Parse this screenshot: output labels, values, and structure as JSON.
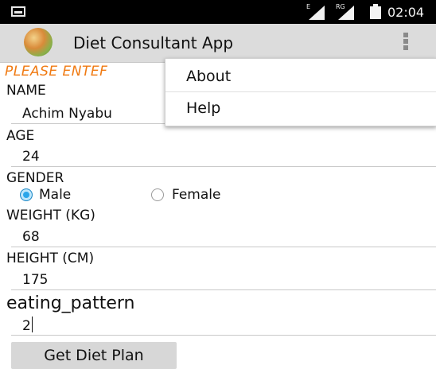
{
  "status_bar": {
    "time": "02:04",
    "network_label": "E",
    "roaming_label": "RG"
  },
  "action_bar": {
    "title": "Diet Consultant App",
    "app_icon": "food-plate-icon",
    "overflow_icon": "overflow-menu-icon"
  },
  "form": {
    "instruction": "PLEASE ENTEF",
    "name_label": "NAME",
    "name_value": "Achim Nyabu",
    "age_label": "AGE",
    "age_value": "24",
    "gender_label": "GENDER",
    "gender_options": [
      "Male",
      "Female"
    ],
    "gender_selected": "Male",
    "weight_label": "WEIGHT (KG)",
    "weight_value": "68",
    "height_label": "HEIGHT (CM)",
    "height_value": "175",
    "eating_label": "eating_pattern",
    "eating_value": "2",
    "submit_label": "Get Diet Plan"
  },
  "overflow_menu": {
    "items": [
      "About",
      "Help"
    ]
  },
  "colors": {
    "accent_orange": "#f07a12",
    "radio_blue": "#2aa6ea",
    "action_bar": "#dcdcdc"
  }
}
